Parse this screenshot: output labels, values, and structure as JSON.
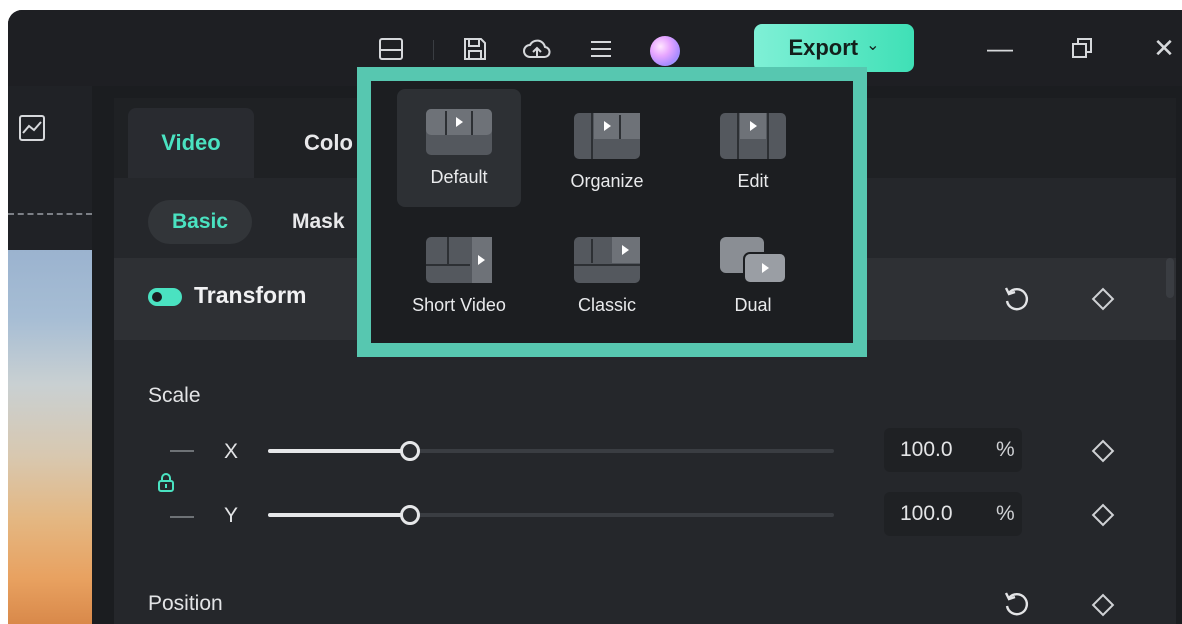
{
  "titlebar": {
    "icons": [
      "layout-icon",
      "save-icon",
      "cloud-upload-icon",
      "menu-icon",
      "avatar"
    ],
    "export_label": "Export",
    "export_chevron": "⌄",
    "minimize": "—",
    "restore": "⧉",
    "close": "✕"
  },
  "panel": {
    "tabs": [
      {
        "label": "Video"
      },
      {
        "label": "Colo"
      }
    ],
    "subtabs": [
      {
        "label": "Basic"
      },
      {
        "label": "Mask"
      }
    ],
    "transform_label": "Transform",
    "scale": {
      "label": "Scale",
      "x": {
        "axis": "X",
        "value": "100.0",
        "unit": "%",
        "slider_fraction": 0.25
      },
      "y": {
        "axis": "Y",
        "value": "100.0",
        "unit": "%",
        "slider_fraction": 0.25
      }
    },
    "position_label": "Position"
  },
  "layout_popup": {
    "items": [
      {
        "label": "Default",
        "selected": true
      },
      {
        "label": "Organize",
        "selected": false
      },
      {
        "label": "Edit",
        "selected": false
      },
      {
        "label": "Short Video",
        "selected": false
      },
      {
        "label": "Classic",
        "selected": false
      },
      {
        "label": "Dual",
        "selected": false
      }
    ]
  },
  "colors": {
    "accent": "#4ae2c1",
    "highlight_frame": "#57c7b0",
    "arrow": "#3fc7b0",
    "export_button": "#4fe6c4",
    "background": "#1b1d20"
  }
}
